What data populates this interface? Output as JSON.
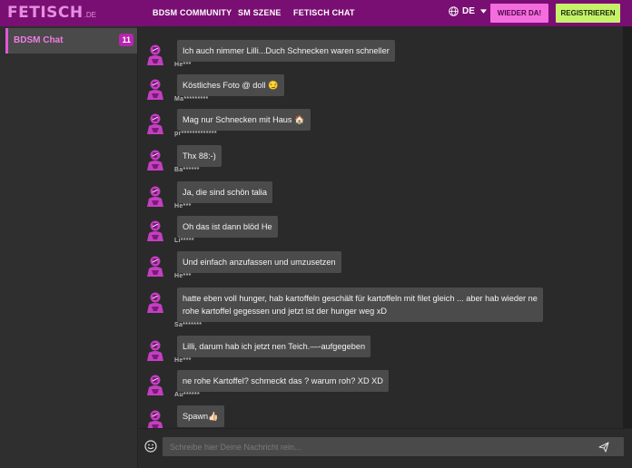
{
  "brand": {
    "logo_main": "FETISCH",
    "logo_tld": ".DE"
  },
  "nav": {
    "links": [
      "BDSM COMMUNITY",
      "SM SZENE",
      "FETISCH CHAT"
    ],
    "language": "DE",
    "login_label": "WIEDER DA!",
    "register_label": "REGISTRIEREN"
  },
  "sidebar": {
    "rooms": [
      {
        "name": "BDSM Chat",
        "count": "11"
      }
    ]
  },
  "messages": [
    {
      "text": "Ich auch nimmer Lilli...Duch Schnecken waren schneller",
      "user": "He***"
    },
    {
      "text": "Köstliches Foto @ doll 😏",
      "user": "Ma*********"
    },
    {
      "text": "Mag nur Schnecken mit Haus 🏠",
      "user": "pr*************"
    },
    {
      "text": "Thx 88:-)",
      "user": "Ba******"
    },
    {
      "text": "Ja, die sind schön talia",
      "user": "He***"
    },
    {
      "text": "Oh das ist dann blöd He",
      "user": "Li*****"
    },
    {
      "text": "Und einfach anzufassen und umzusetzen",
      "user": "He***"
    },
    {
      "text": "hatte eben voll hunger, hab kartoffeln geschält für kartoffeln mit filet gleich ... aber hab wieder ne rohe kartoffel gegessen und jetzt ist der hunger weg xD",
      "user": "Sa*******"
    },
    {
      "text": "Lilli, darum hab ich jetzt nen Teich.—-aufgegeben",
      "user": "He***"
    },
    {
      "text": "ne rohe Kartoffel? schmeckt das ? warum roh? XD XD",
      "user": "Au******"
    },
    {
      "text": "Spawn👍🏻",
      "user": ""
    }
  ],
  "composer": {
    "placeholder": "Schreibe hier Deine Nachricht rein..."
  },
  "colors": {
    "topbar": "#7a0f73",
    "accent_pink": "#f46cde",
    "accent_green": "#c6f26a",
    "bubble": "#4b4b4b",
    "background": "#2a2a2a"
  },
  "icons": [
    "globe-icon",
    "chevron-down-icon",
    "avatar-icon",
    "smiley-icon",
    "send-icon"
  ]
}
